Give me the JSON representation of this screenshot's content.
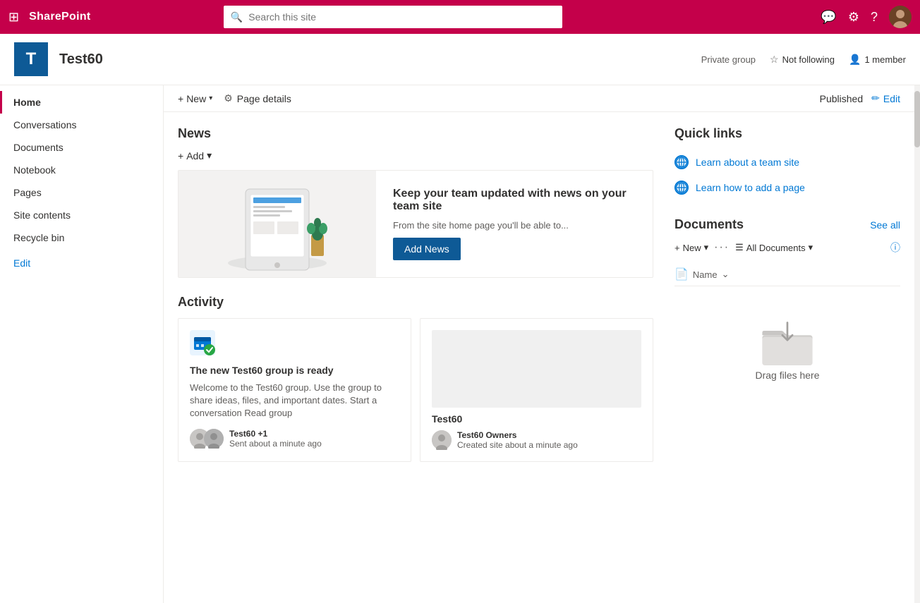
{
  "topnav": {
    "logo": "SharePoint",
    "search_placeholder": "Search this site",
    "icons": [
      "chat",
      "settings",
      "help",
      "avatar"
    ]
  },
  "site_header": {
    "logo_letter": "T",
    "site_name": "Test60",
    "private_group": "Private group",
    "not_following": "Not following",
    "member_count": "1 member"
  },
  "toolbar": {
    "new_label": "New",
    "page_details_label": "Page details",
    "published_label": "Published",
    "edit_label": "Edit"
  },
  "sidebar": {
    "items": [
      {
        "label": "Home",
        "active": true
      },
      {
        "label": "Conversations",
        "active": false
      },
      {
        "label": "Documents",
        "active": false
      },
      {
        "label": "Notebook",
        "active": false
      },
      {
        "label": "Pages",
        "active": false
      },
      {
        "label": "Site contents",
        "active": false
      },
      {
        "label": "Recycle bin",
        "active": false
      },
      {
        "label": "Edit",
        "active": false,
        "edit": true
      }
    ]
  },
  "news": {
    "title": "News",
    "add_label": "Add",
    "card": {
      "heading": "Keep your team updated with news on your team site",
      "body": "From the site home page you'll be able to...",
      "button": "Add News"
    }
  },
  "activity": {
    "title": "Activity",
    "cards": [
      {
        "icon": "📅",
        "title": "The new Test60 group is ready",
        "text": "Welcome to the Test60 group. Use the group to share ideas, files, and important dates. Start a conversation Read group",
        "author": "Test60 +1",
        "timestamp": "Sent about a minute ago"
      },
      {
        "title": "Test60",
        "author": "Test60 Owners",
        "timestamp": "Created site about a minute ago"
      }
    ]
  },
  "quick_links": {
    "title": "Quick links",
    "items": [
      {
        "label": "Learn about a team site"
      },
      {
        "label": "Learn how to add a page"
      }
    ]
  },
  "documents": {
    "title": "Documents",
    "see_all": "See all",
    "new_label": "New",
    "view_label": "All Documents",
    "column_header": "Name",
    "drag_text": "Drag files here"
  }
}
